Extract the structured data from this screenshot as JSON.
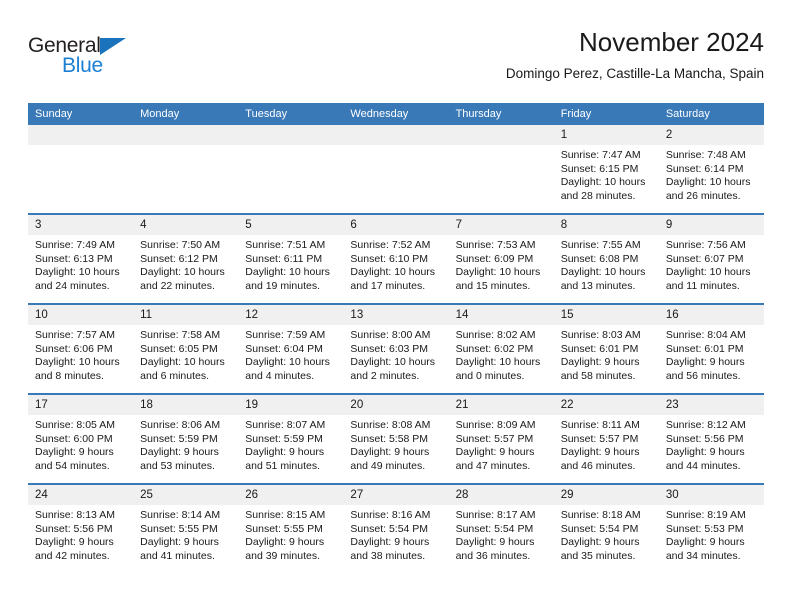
{
  "brand": {
    "name_dark": "General",
    "name_light": "Blue",
    "accent_color": "#1b7fd4",
    "triangle_color": "#1b74bb"
  },
  "header": {
    "title": "November 2024",
    "subtitle": "Domingo Perez, Castille-La Mancha, Spain",
    "header_bg": "#3a79b8",
    "daynum_bg": "#f0f0f0"
  },
  "calendar": {
    "weekday_headers": [
      "Sunday",
      "Monday",
      "Tuesday",
      "Wednesday",
      "Thursday",
      "Friday",
      "Saturday"
    ],
    "weeks": [
      [
        {
          "day": "",
          "empty": true
        },
        {
          "day": "",
          "empty": true
        },
        {
          "day": "",
          "empty": true
        },
        {
          "day": "",
          "empty": true
        },
        {
          "day": "",
          "empty": true
        },
        {
          "day": "1",
          "sunrise": "Sunrise: 7:47 AM",
          "sunset": "Sunset: 6:15 PM",
          "daylight": "Daylight: 10 hours and 28 minutes."
        },
        {
          "day": "2",
          "sunrise": "Sunrise: 7:48 AM",
          "sunset": "Sunset: 6:14 PM",
          "daylight": "Daylight: 10 hours and 26 minutes."
        }
      ],
      [
        {
          "day": "3",
          "sunrise": "Sunrise: 7:49 AM",
          "sunset": "Sunset: 6:13 PM",
          "daylight": "Daylight: 10 hours and 24 minutes."
        },
        {
          "day": "4",
          "sunrise": "Sunrise: 7:50 AM",
          "sunset": "Sunset: 6:12 PM",
          "daylight": "Daylight: 10 hours and 22 minutes."
        },
        {
          "day": "5",
          "sunrise": "Sunrise: 7:51 AM",
          "sunset": "Sunset: 6:11 PM",
          "daylight": "Daylight: 10 hours and 19 minutes."
        },
        {
          "day": "6",
          "sunrise": "Sunrise: 7:52 AM",
          "sunset": "Sunset: 6:10 PM",
          "daylight": "Daylight: 10 hours and 17 minutes."
        },
        {
          "day": "7",
          "sunrise": "Sunrise: 7:53 AM",
          "sunset": "Sunset: 6:09 PM",
          "daylight": "Daylight: 10 hours and 15 minutes."
        },
        {
          "day": "8",
          "sunrise": "Sunrise: 7:55 AM",
          "sunset": "Sunset: 6:08 PM",
          "daylight": "Daylight: 10 hours and 13 minutes."
        },
        {
          "day": "9",
          "sunrise": "Sunrise: 7:56 AM",
          "sunset": "Sunset: 6:07 PM",
          "daylight": "Daylight: 10 hours and 11 minutes."
        }
      ],
      [
        {
          "day": "10",
          "sunrise": "Sunrise: 7:57 AM",
          "sunset": "Sunset: 6:06 PM",
          "daylight": "Daylight: 10 hours and 8 minutes."
        },
        {
          "day": "11",
          "sunrise": "Sunrise: 7:58 AM",
          "sunset": "Sunset: 6:05 PM",
          "daylight": "Daylight: 10 hours and 6 minutes."
        },
        {
          "day": "12",
          "sunrise": "Sunrise: 7:59 AM",
          "sunset": "Sunset: 6:04 PM",
          "daylight": "Daylight: 10 hours and 4 minutes."
        },
        {
          "day": "13",
          "sunrise": "Sunrise: 8:00 AM",
          "sunset": "Sunset: 6:03 PM",
          "daylight": "Daylight: 10 hours and 2 minutes."
        },
        {
          "day": "14",
          "sunrise": "Sunrise: 8:02 AM",
          "sunset": "Sunset: 6:02 PM",
          "daylight": "Daylight: 10 hours and 0 minutes."
        },
        {
          "day": "15",
          "sunrise": "Sunrise: 8:03 AM",
          "sunset": "Sunset: 6:01 PM",
          "daylight": "Daylight: 9 hours and 58 minutes."
        },
        {
          "day": "16",
          "sunrise": "Sunrise: 8:04 AM",
          "sunset": "Sunset: 6:01 PM",
          "daylight": "Daylight: 9 hours and 56 minutes."
        }
      ],
      [
        {
          "day": "17",
          "sunrise": "Sunrise: 8:05 AM",
          "sunset": "Sunset: 6:00 PM",
          "daylight": "Daylight: 9 hours and 54 minutes."
        },
        {
          "day": "18",
          "sunrise": "Sunrise: 8:06 AM",
          "sunset": "Sunset: 5:59 PM",
          "daylight": "Daylight: 9 hours and 53 minutes."
        },
        {
          "day": "19",
          "sunrise": "Sunrise: 8:07 AM",
          "sunset": "Sunset: 5:59 PM",
          "daylight": "Daylight: 9 hours and 51 minutes."
        },
        {
          "day": "20",
          "sunrise": "Sunrise: 8:08 AM",
          "sunset": "Sunset: 5:58 PM",
          "daylight": "Daylight: 9 hours and 49 minutes."
        },
        {
          "day": "21",
          "sunrise": "Sunrise: 8:09 AM",
          "sunset": "Sunset: 5:57 PM",
          "daylight": "Daylight: 9 hours and 47 minutes."
        },
        {
          "day": "22",
          "sunrise": "Sunrise: 8:11 AM",
          "sunset": "Sunset: 5:57 PM",
          "daylight": "Daylight: 9 hours and 46 minutes."
        },
        {
          "day": "23",
          "sunrise": "Sunrise: 8:12 AM",
          "sunset": "Sunset: 5:56 PM",
          "daylight": "Daylight: 9 hours and 44 minutes."
        }
      ],
      [
        {
          "day": "24",
          "sunrise": "Sunrise: 8:13 AM",
          "sunset": "Sunset: 5:56 PM",
          "daylight": "Daylight: 9 hours and 42 minutes."
        },
        {
          "day": "25",
          "sunrise": "Sunrise: 8:14 AM",
          "sunset": "Sunset: 5:55 PM",
          "daylight": "Daylight: 9 hours and 41 minutes."
        },
        {
          "day": "26",
          "sunrise": "Sunrise: 8:15 AM",
          "sunset": "Sunset: 5:55 PM",
          "daylight": "Daylight: 9 hours and 39 minutes."
        },
        {
          "day": "27",
          "sunrise": "Sunrise: 8:16 AM",
          "sunset": "Sunset: 5:54 PM",
          "daylight": "Daylight: 9 hours and 38 minutes."
        },
        {
          "day": "28",
          "sunrise": "Sunrise: 8:17 AM",
          "sunset": "Sunset: 5:54 PM",
          "daylight": "Daylight: 9 hours and 36 minutes."
        },
        {
          "day": "29",
          "sunrise": "Sunrise: 8:18 AM",
          "sunset": "Sunset: 5:54 PM",
          "daylight": "Daylight: 9 hours and 35 minutes."
        },
        {
          "day": "30",
          "sunrise": "Sunrise: 8:19 AM",
          "sunset": "Sunset: 5:53 PM",
          "daylight": "Daylight: 9 hours and 34 minutes."
        }
      ]
    ]
  }
}
